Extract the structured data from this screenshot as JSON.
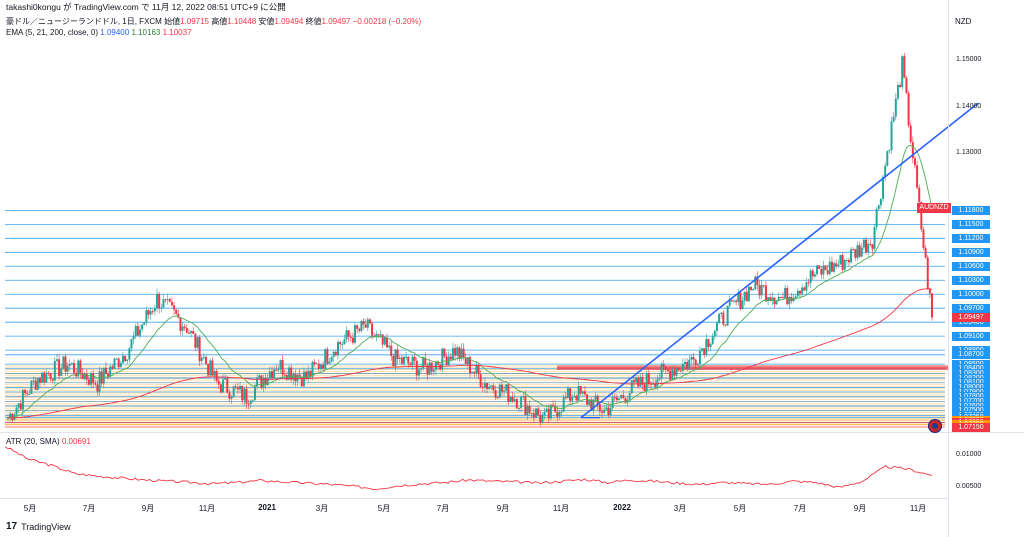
{
  "attribution": "takashi0kongu が TradingView.com で 11月 12, 2022 08:51 UTC+9 に公開",
  "header": {
    "symbol": "豪ドル／ニュージーランドドル, 1日, FXCM",
    "open_label": "始値",
    "open": "1.09715",
    "high_label": "高値",
    "high": "1.10448",
    "low_label": "安値",
    "low": "1.09494",
    "close_label": "終値",
    "close": "1.09497",
    "change": "−0.00218 (−0.20%)"
  },
  "ema": {
    "label": "EMA (5, 21, 200, close, 0)",
    "v1": "1.09400",
    "v2": "1.10163",
    "v3": "1.10037"
  },
  "atr": {
    "label": "ATR (20, SMA)",
    "value": "0.00691"
  },
  "currency": "NZD",
  "symbol_badge": "AUDNZD",
  "logo_text": "TradingView",
  "colors": {
    "up": "#26a69a",
    "down": "#f23645",
    "blue_level": "#2196f3",
    "orange_level": "#ff9800",
    "trend": "#2962ff",
    "ema_fast": "#2962ff",
    "ema_mid": "#4caf50",
    "ema_slow": "#f23645",
    "atr": "#f23645"
  },
  "chart_data": [
    {
      "type": "line",
      "title": "豪ドル／ニュージーランドドル, 1日, FXCM",
      "x_ticks": [
        "5月",
        "7月",
        "9月",
        "11月",
        "2021",
        "3月",
        "5月",
        "7月",
        "9月",
        "11月",
        "2022",
        "3月",
        "5月",
        "7月",
        "9月",
        "11月"
      ],
      "y_range": [
        1.0715,
        1.152
      ],
      "y_ticks": [
        "1.15000",
        "1.14000",
        "1.13000"
      ],
      "series": [
        {
          "x": [
            "2020-04",
            "2020-05",
            "2020-06",
            "2020-07",
            "2020-08",
            "2020-09",
            "2020-10",
            "2020-11",
            "2020-12",
            "2021-01",
            "2021-02",
            "2021-03",
            "2021-04",
            "2021-05",
            "2021-06",
            "2021-07",
            "2021-08",
            "2021-09",
            "2021-10",
            "2021-11",
            "2021-12",
            "2022-01",
            "2022-02",
            "2022-03",
            "2022-04",
            "2022-05",
            "2022-06",
            "2022-07",
            "2022-08",
            "2022-09",
            "2022-10",
            "2022-11"
          ],
          "values": [
            1.0735,
            1.082,
            1.085,
            1.081,
            1.088,
            1.099,
            1.093,
            1.081,
            1.078,
            1.085,
            1.082,
            1.089,
            1.093,
            1.086,
            1.084,
            1.088,
            1.081,
            1.078,
            1.073,
            1.079,
            1.075,
            1.08,
            1.083,
            1.086,
            1.095,
            1.102,
            1.099,
            1.104,
            1.107,
            1.112,
            1.149,
            1.095
          ]
        }
      ],
      "levels": [
        "1.11800",
        "1.11500",
        "1.11200",
        "1.10900",
        "1.10600",
        "1.10300",
        "1.10000",
        "1.09700",
        "1.09400",
        "1.09100",
        "1.08800",
        "1.08700",
        "1.08500",
        "1.08400",
        "1.08300",
        "1.08200",
        "1.08100",
        "1.08000",
        "1.07900",
        "1.07800",
        "1.07700",
        "1.07600",
        "1.07500",
        "1.07400",
        "1.07350",
        "1.07300",
        "1.07250",
        "1.07250",
        "1.07200",
        "1.07150"
      ],
      "level_colors": [
        "#2196f3",
        "#2196f3",
        "#2196f3",
        "#2196f3",
        "#2196f3",
        "#2196f3",
        "#2196f3",
        "#2196f3",
        "#2196f3",
        "#2196f3",
        "#2196f3",
        "#2196f3",
        "#2196f3",
        "#2196f3",
        "#2196f3",
        "#2196f3",
        "#2196f3",
        "#2196f3",
        "#2196f3",
        "#2196f3",
        "#2196f3",
        "#2196f3",
        "#2196f3",
        "#2196f3",
        "#2196f3",
        "#ff9800",
        "#2962ff",
        "#f23645",
        "#ff9800",
        "#f23645"
      ],
      "last_price": "1.09497"
    },
    {
      "type": "line",
      "title": "ATR (20, SMA)",
      "y_range": [
        0.0035,
        0.0125
      ],
      "y_ticks": [
        "0.01000",
        "0.00500"
      ],
      "series": [
        {
          "values": [
            0.0115,
            0.0095,
            0.0085,
            0.0072,
            0.0068,
            0.0065,
            0.0062,
            0.006,
            0.0058,
            0.0056,
            0.0058,
            0.0061,
            0.0059,
            0.0057,
            0.0055,
            0.0052,
            0.0048,
            0.0053,
            0.0056,
            0.0058,
            0.0062,
            0.006,
            0.0059,
            0.0057,
            0.006,
            0.0063,
            0.0058,
            0.0062,
            0.006,
            0.0057,
            0.0055,
            0.0058,
            0.0056,
            0.0055,
            0.006,
            0.0058,
            0.005,
            0.006,
            0.0083,
            0.0079,
            0.00691
          ]
        }
      ]
    }
  ]
}
